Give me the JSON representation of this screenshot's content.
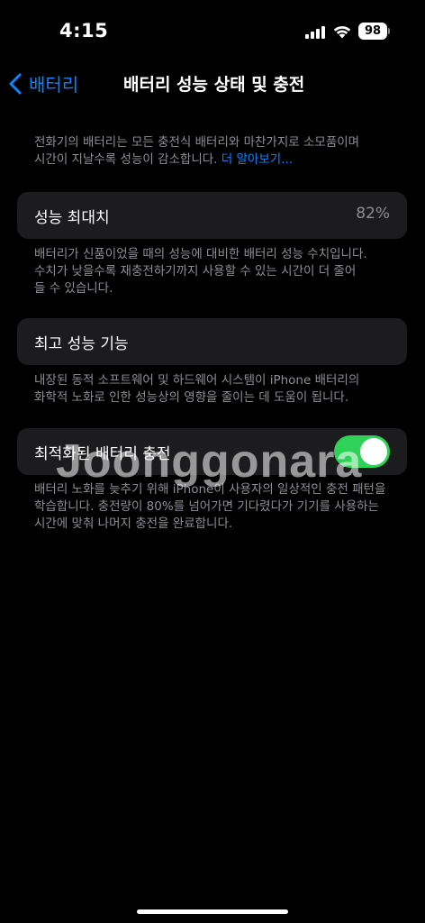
{
  "status": {
    "time": "4:15",
    "battery": "98"
  },
  "nav": {
    "back_label": "배터리",
    "title": "배터리 성능 상태 및 충전"
  },
  "intro": {
    "text_line1": "전화기의 배터리는 모든 충전식 배터리와 마찬가지로 소모품이며",
    "text_line2": "시간이 지날수록 성능이 감소합니다. ",
    "link": "더 알아보기..."
  },
  "performance": {
    "label": "성능 최대치",
    "value": "82%",
    "desc_line1": "배터리가 신품이었을 때의 성능에 대비한 배터리 성능 수치입니다.",
    "desc_line2": "수치가 낮을수록 재충전하기까지 사용할 수 있는 시간이 더 줄어",
    "desc_line3": "들 수 있습니다."
  },
  "peak": {
    "label": "최고 성능 기능",
    "desc_line1": "내장된 동적 소프트웨어 및 하드웨어 시스템이 iPhone 배터리의",
    "desc_line2": "화학적 노화로 인한 성능상의 영향을 줄이는 데 도움이 됩니다."
  },
  "optimized": {
    "label": "최적화된 배터리 충전",
    "enabled": true,
    "desc_line1": "배터리 노화를 늦추기 위해 iPhone이 사용자의 일상적인 충전 패턴을",
    "desc_line2": "학습합니다. 충전량이 80%를 넘어가면 기다렸다가 기기를 사용하는",
    "desc_line3": "시간에 맞춰 나머지 충전을 완료합니다."
  },
  "watermark": "Joonggonara",
  "colors": {
    "accent": "#0a84ff",
    "toggle_on": "#30d158",
    "card_bg": "#1c1c1e"
  }
}
